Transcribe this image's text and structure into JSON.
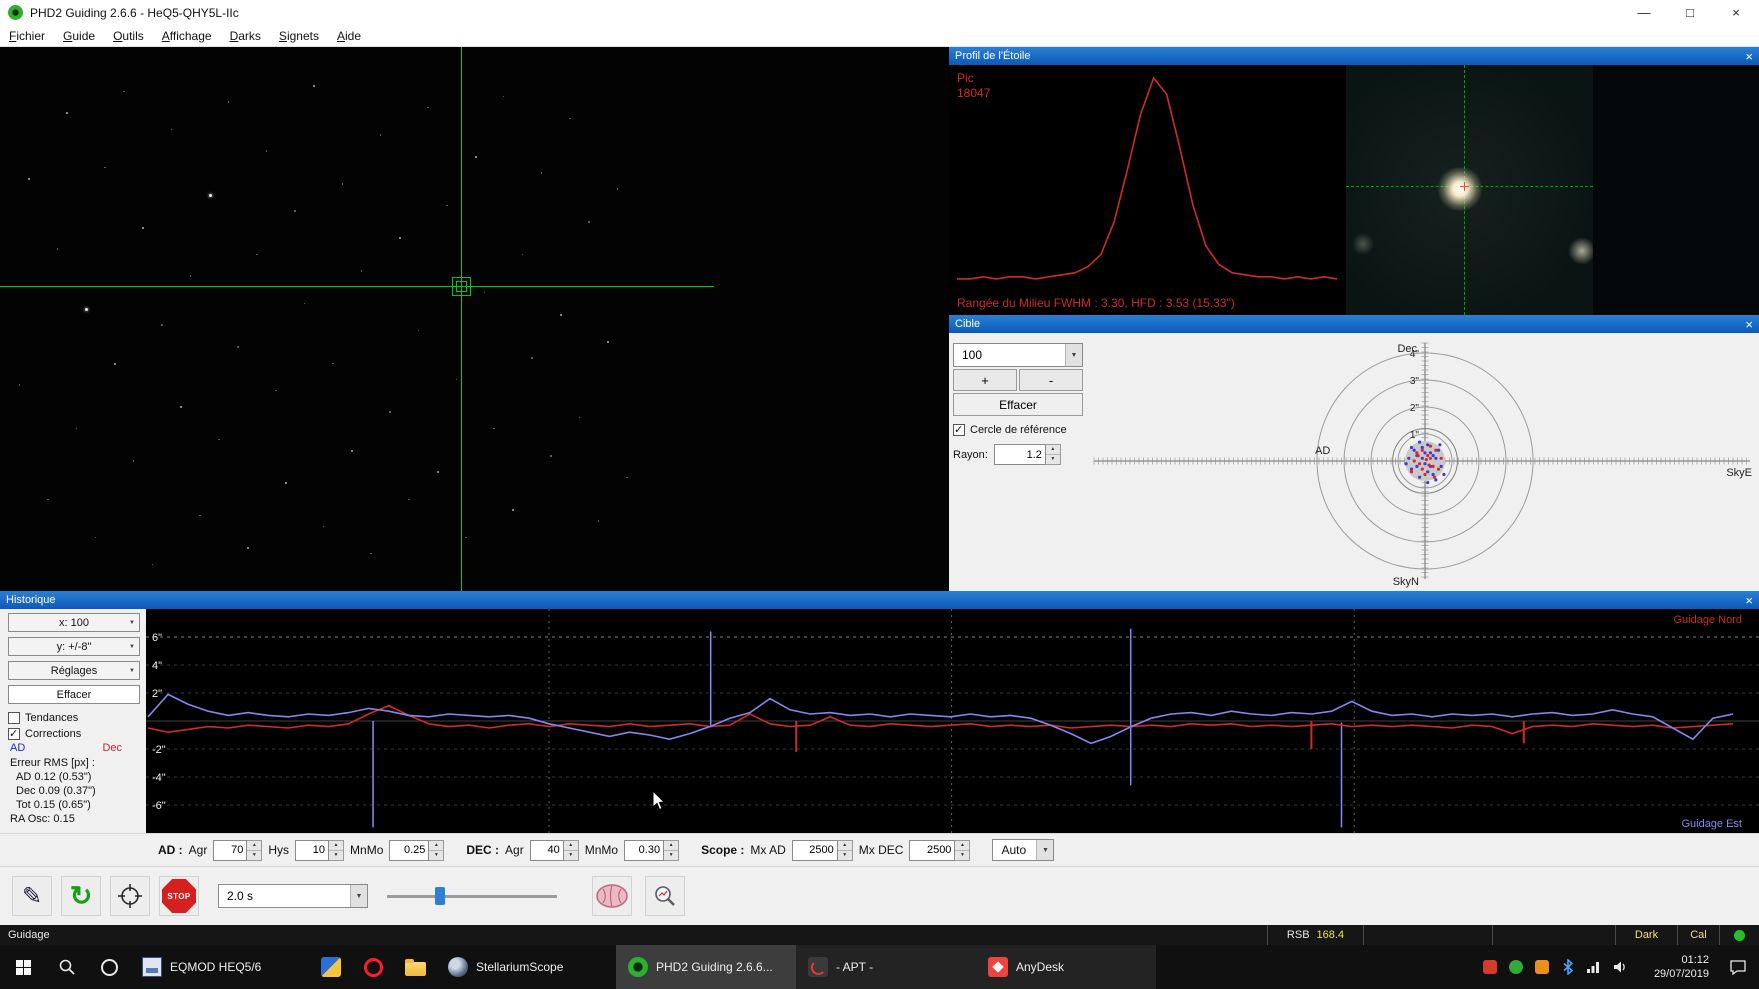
{
  "ui": {
    "close_x": "×",
    "min": "—",
    "max": "□",
    "check": "✓",
    "combo_arrow": "▼",
    "spin_up": "▲",
    "spin_down": "▼"
  },
  "window": {
    "title": "PHD2 Guiding 2.6.6 - HeQ5-QHY5L-IIc",
    "menu_items": [
      "Fichier",
      "Guide",
      "Outils",
      "Affichage",
      "Darks",
      "Signets",
      "Aide"
    ]
  },
  "profile": {
    "title": "Profil de l'Étoile",
    "peak_label": "Pic",
    "peak_value": "18047",
    "fwhm_text": "Rangée du Milieu FWHM : 3.30, HFD : 3.53 (15.33\")",
    "curve": [
      0.02,
      0.02,
      0.03,
      0.02,
      0.03,
      0.03,
      0.02,
      0.03,
      0.04,
      0.05,
      0.08,
      0.14,
      0.3,
      0.55,
      0.82,
      1.0,
      0.92,
      0.66,
      0.38,
      0.18,
      0.09,
      0.05,
      0.04,
      0.03,
      0.03,
      0.02,
      0.03,
      0.02,
      0.03,
      0.02
    ]
  },
  "target": {
    "title": "Cible",
    "zoom_value": "100",
    "plus_label": "+",
    "minus_label": "-",
    "clear_label": "Effacer",
    "ref_circle_label": "Cercle de référence",
    "radius_label": "Rayon:",
    "radius_value": "1.2",
    "labels": {
      "top": "Dec",
      "left": "AD",
      "right": "SkyE",
      "bottom": "SkyN"
    },
    "tick_labels": [
      "4\"",
      "3\"",
      "2\"",
      "1\""
    ],
    "points_blue": [
      [
        -0.3,
        0.2
      ],
      [
        0.1,
        -0.4
      ],
      [
        0.4,
        0.1
      ],
      [
        -0.5,
        -0.3
      ],
      [
        0.2,
        0.3
      ],
      [
        -0.1,
        0.5
      ],
      [
        0.6,
        -0.2
      ],
      [
        -0.4,
        0.4
      ],
      [
        0,
        -0.1
      ],
      [
        0.3,
        -0.5
      ],
      [
        -0.2,
        -0.6
      ],
      [
        0.5,
        0.4
      ],
      [
        -0.6,
        0.1
      ],
      [
        0.1,
        0.6
      ],
      [
        0.7,
        -0.5
      ],
      [
        -0.3,
        -0.2
      ],
      [
        0.2,
        -0.2
      ],
      [
        -0.1,
        0.1
      ],
      [
        0.4,
        -0.7
      ],
      [
        -0.5,
        0.5
      ],
      [
        0,
        0.3
      ],
      [
        0.3,
        0.2
      ],
      [
        -0.7,
        -0.1
      ],
      [
        0.1,
        -0.8
      ],
      [
        0.55,
        0.6
      ],
      [
        -0.2,
        0.7
      ]
    ],
    "points_red": [
      [
        0.2,
        0.1
      ],
      [
        -0.1,
        -0.3
      ],
      [
        0.3,
        -0.2
      ],
      [
        -0.3,
        0.3
      ],
      [
        0.1,
        0.2
      ],
      [
        0.4,
        0.4
      ],
      [
        -0.2,
        -0.1
      ],
      [
        0,
        -0.5
      ],
      [
        0.5,
        -0.3
      ],
      [
        -0.4,
        0
      ],
      [
        0.2,
        0.55
      ],
      [
        -0.1,
        0.4
      ],
      [
        0.35,
        -0.6
      ],
      [
        -0.5,
        -0.4
      ],
      [
        0.15,
        -0.15
      ],
      [
        0.6,
        0.1
      ],
      [
        -0.25,
        0.2
      ],
      [
        0.05,
        0.05
      ]
    ]
  },
  "history": {
    "title": "Historique",
    "x_scale": "x: 100",
    "y_scale": "y: +/-8\"",
    "settings_label": "Réglages",
    "clear_label": "Effacer",
    "trend_label": "Tendances",
    "corrections_label": "Corrections",
    "ad_label": "AD",
    "dec_label": "Dec",
    "rms_heading": "Erreur RMS [px] :",
    "rms_lines": [
      "AD 0.12 (0.53\")",
      "Dec 0.09 (0.37\")",
      "Tot 0.15 (0.65\")"
    ],
    "ra_osc": "RA Osc: 0.15",
    "legend_north": "Guidage Nord",
    "legend_east": "Guidage Est",
    "y_ticks": [
      6,
      4,
      2,
      -2,
      -4,
      -6
    ],
    "y_tick_labels": [
      "6\"",
      "4\"",
      "2\"",
      "-2\"",
      "-4\"",
      "-6\""
    ],
    "vgrid": [
      0.253,
      0.507,
      0.761
    ],
    "ra_series": [
      0.3,
      1.9,
      1.2,
      0.7,
      0.4,
      0.6,
      0.4,
      0.3,
      0.5,
      0.4,
      0.6,
      0.9,
      0.7,
      0.4,
      0.3,
      0.5,
      0.4,
      0.3,
      0.4,
      0.2,
      -0.2,
      -0.5,
      -0.8,
      -1.1,
      -0.8,
      -1.0,
      -1.3,
      -0.9,
      -0.4,
      0.2,
      0.6,
      1.6,
      0.8,
      0.5,
      0.6,
      0.4,
      0.5,
      0.3,
      0.5,
      0.4,
      0.3,
      0.5,
      0.3,
      0.4,
      0.2,
      -0.3,
      -0.9,
      -1.6,
      -1.1,
      -0.4,
      0.2,
      0.5,
      0.6,
      0.4,
      0.7,
      0.5,
      0.4,
      0.6,
      0.5,
      0.7,
      1.4,
      0.7,
      0.4,
      0.5,
      0.3,
      0.5,
      0.4,
      0.5,
      0.3,
      0.5,
      0.6,
      0.4,
      0.5,
      0.8,
      0.5,
      0.3,
      -0.5,
      -1.3,
      0.2,
      0.5
    ],
    "dec_series": [
      -0.5,
      -0.8,
      -0.6,
      -0.4,
      -0.5,
      -0.3,
      -0.4,
      -0.5,
      -0.3,
      -0.4,
      -0.2,
      0.5,
      1.1,
      0.4,
      -0.2,
      -0.4,
      -0.3,
      -0.5,
      -0.3,
      -0.2,
      -0.4,
      -0.2,
      -0.3,
      -0.4,
      -0.2,
      -0.4,
      -0.3,
      -0.2,
      -0.4,
      -0.3,
      0.5,
      -0.2,
      -0.4,
      -0.3,
      0.3,
      -0.3,
      -0.4,
      -0.2,
      -0.3,
      -0.4,
      -0.3,
      -0.2,
      -0.4,
      -0.3,
      -0.4,
      -0.3,
      -0.5,
      -0.4,
      -0.3,
      -0.4,
      -0.3,
      -0.4,
      -0.2,
      -0.3,
      -0.2,
      -0.4,
      -0.3,
      -0.4,
      -0.3,
      -0.2,
      -0.4,
      -0.3,
      -0.4,
      -0.3,
      -0.4,
      -0.5,
      -0.3,
      -0.4,
      -0.9,
      -0.4,
      -0.3,
      -0.4,
      -0.2,
      -0.3,
      -0.4,
      -0.3,
      -0.5,
      -0.4,
      -0.3,
      -0.2
    ],
    "events": [
      {
        "x": 0.142,
        "y1": 0,
        "y2": -7.6
      },
      {
        "x": 0.355,
        "y1": 6.4,
        "y2": -0.3
      },
      {
        "x": 0.62,
        "y1": 6.6,
        "y2": -4.6
      },
      {
        "x": 0.753,
        "y1": -0.1,
        "y2": -7.6
      }
    ],
    "corrections_red": [
      {
        "x": 0.409,
        "v": -2.2
      },
      {
        "x": 0.734,
        "v": -2.0
      },
      {
        "x": 0.868,
        "v": -1.6
      }
    ]
  },
  "params": {
    "ad_label": "AD :",
    "agr_label": "Agr",
    "agr_value": "70",
    "hys_label": "Hys",
    "hys_value": "10",
    "mnmo_label": "MnMo",
    "mnmo_value": "0.25",
    "dec_label": "DEC :",
    "dec_agr_label": "Agr",
    "dec_agr_value": "40",
    "dec_mnmo_label": "MnMo",
    "dec_mnmo_value": "0.30",
    "scope_label": "Scope :",
    "mxad_label": "Mx AD",
    "mxad_value": "2500",
    "mxdec_label": "Mx DEC",
    "mxdec_value": "2500",
    "auto_label": "Auto"
  },
  "toolbar": {
    "exposure_value": "2.0 s",
    "stop_label": "STOP"
  },
  "statusbar": {
    "state": "Guidage",
    "rsb_label": "RSB",
    "rsb_value": "168.4",
    "dark_label": "Dark",
    "cal_label": "Cal"
  },
  "taskbar": {
    "apps": [
      {
        "label": "EQMOD HEQ5/6"
      },
      {
        "label": "StellariumScope"
      },
      {
        "label": "PHD2 Guiding 2.6.6..."
      },
      {
        "label": "- APT -"
      },
      {
        "label": "AnyDesk"
      }
    ],
    "time": "01:12",
    "date": "29/07/2019"
  },
  "starfield": {
    "stars": [
      [
        2,
        62,
        1
      ],
      [
        3,
        24,
        2
      ],
      [
        5,
        83,
        1
      ],
      [
        6,
        37,
        1
      ],
      [
        7,
        12,
        2
      ],
      [
        8,
        70,
        1
      ],
      [
        9,
        48,
        3
      ],
      [
        10,
        90,
        1
      ],
      [
        11,
        22,
        1
      ],
      [
        12,
        58,
        2
      ],
      [
        13,
        8,
        1
      ],
      [
        14,
        76,
        1
      ],
      [
        15,
        33,
        2
      ],
      [
        16,
        95,
        1
      ],
      [
        17,
        51,
        1
      ],
      [
        18,
        15,
        1
      ],
      [
        19,
        66,
        2
      ],
      [
        20,
        42,
        1
      ],
      [
        21,
        86,
        1
      ],
      [
        22,
        27,
        3
      ],
      [
        23,
        72,
        1
      ],
      [
        24,
        10,
        1
      ],
      [
        25,
        55,
        1
      ],
      [
        26,
        92,
        2
      ],
      [
        27,
        38,
        1
      ],
      [
        28,
        19,
        1
      ],
      [
        29,
        63,
        1
      ],
      [
        30,
        80,
        2
      ],
      [
        31,
        30,
        1
      ],
      [
        32,
        47,
        1
      ],
      [
        33,
        7,
        2
      ],
      [
        34,
        88,
        1
      ],
      [
        35,
        58,
        1
      ],
      [
        36,
        25,
        1
      ],
      [
        37,
        74,
        2
      ],
      [
        38,
        41,
        1
      ],
      [
        39,
        93,
        1
      ],
      [
        40,
        16,
        1
      ],
      [
        41,
        67,
        1
      ],
      [
        42,
        35,
        2
      ],
      [
        43,
        83,
        1
      ],
      [
        44,
        52,
        1
      ],
      [
        45,
        11,
        1
      ],
      [
        46,
        78,
        2
      ],
      [
        47,
        29,
        1
      ],
      [
        48,
        61,
        1
      ],
      [
        49,
        90,
        1
      ],
      [
        50,
        20,
        2
      ],
      [
        51,
        45,
        1
      ],
      [
        52,
        70,
        1
      ],
      [
        53,
        9,
        1
      ],
      [
        54,
        85,
        2
      ],
      [
        55,
        38,
        1
      ],
      [
        56,
        57,
        1
      ],
      [
        57,
        23,
        1
      ],
      [
        58,
        75,
        1
      ],
      [
        59,
        49,
        2
      ],
      [
        60,
        13,
        1
      ],
      [
        61,
        68,
        1
      ],
      [
        62,
        32,
        1
      ],
      [
        63,
        87,
        1
      ],
      [
        64,
        54,
        2
      ],
      [
        65,
        26,
        1
      ],
      [
        66,
        79,
        1
      ]
    ]
  }
}
